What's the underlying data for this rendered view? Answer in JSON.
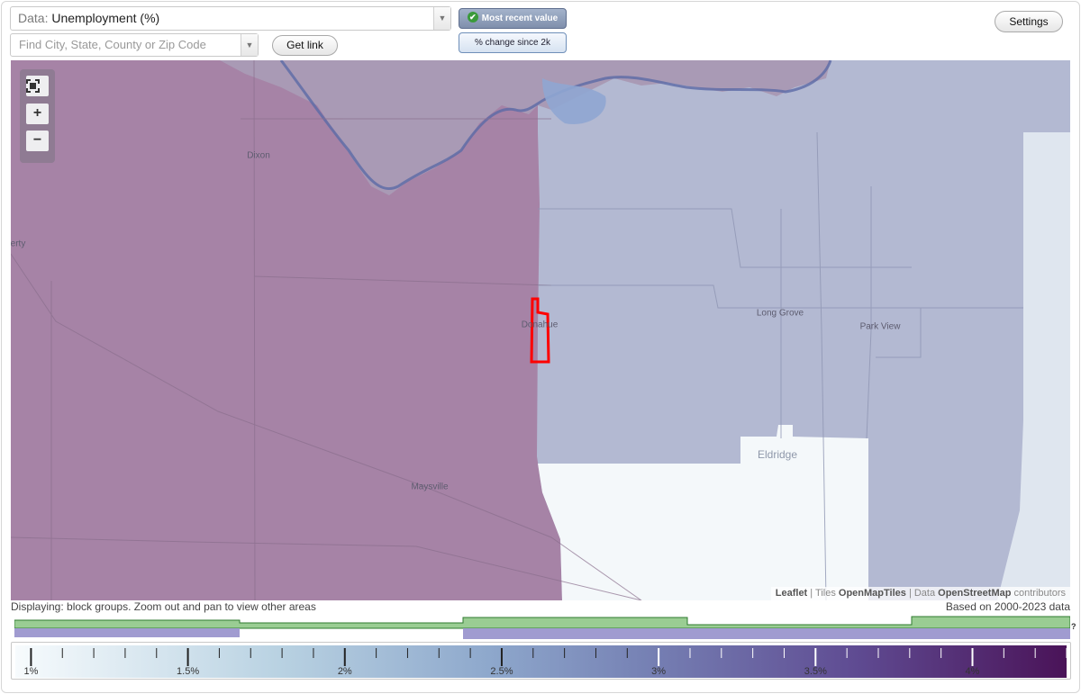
{
  "controls": {
    "data_prefix": "Data:",
    "data_value": "Unemployment (%)",
    "search_placeholder": "Find City, State, County or Zip Code",
    "get_link_label": "Get link",
    "settings_label": "Settings",
    "mode_recent_label": "Most recent value",
    "mode_change_label": "% change since 2k",
    "zoom_in": "+",
    "zoom_out": "−"
  },
  "map": {
    "place_labels": {
      "dixon": "Dixon",
      "liberty": "erty",
      "donahue": "Donahue",
      "long_grove": "Long Grove",
      "park_view": "Park View",
      "maysville": "Maysville",
      "eldridge": "Eldridge"
    },
    "attribution": {
      "leaflet": "Leaflet",
      "tiles_prefix": "| Tiles",
      "tiles": "OpenMapTiles",
      "data_prefix": "| Data",
      "data": "OpenStreetMap",
      "suffix": "contributors"
    },
    "colors": {
      "purple_region": "#a683a6",
      "blue_region": "#b3b9d2",
      "light_region": "#f4f8fa",
      "highlight": "#ff0000"
    }
  },
  "footer": {
    "displaying": "Displaying: block groups. Zoom out and pan to view other areas",
    "based_on": "Based on 2000-2023 data",
    "timeline_help": "?"
  },
  "legend": {
    "min": 0.95,
    "max": 4.3,
    "major_ticks": [
      "1%",
      "1.5%",
      "2%",
      "2.5%",
      "3%",
      "3.5%",
      "4%"
    ],
    "major_values": [
      1,
      1.5,
      2,
      2.5,
      3,
      3.5,
      4
    ]
  }
}
